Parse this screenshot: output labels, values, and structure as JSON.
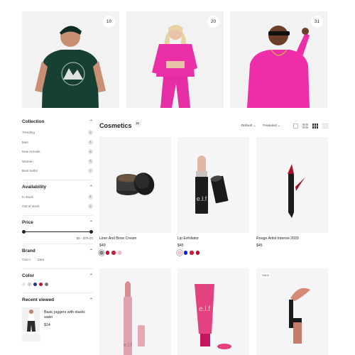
{
  "collections": [
    {
      "count": "10"
    },
    {
      "count": "20"
    },
    {
      "count": "31"
    }
  ],
  "sidebar": {
    "collection": {
      "title": "Collection",
      "items": [
        {
          "label": "Trending",
          "count": "2"
        },
        {
          "label": "Men",
          "count": "4"
        },
        {
          "label": "New Arrivals",
          "count": "6"
        },
        {
          "label": "Women",
          "count": "3"
        },
        {
          "label": "Best Seller",
          "count": "7"
        }
      ]
    },
    "availability": {
      "title": "Availability",
      "items": [
        {
          "label": "In stock",
          "count": "4"
        },
        {
          "label": "Out of stock",
          "count": "2"
        }
      ]
    },
    "price": {
      "title": "Price",
      "range": "$0 - $79.00"
    },
    "brand": {
      "title": "Brand",
      "items": [
        "Gucci",
        "Zara"
      ]
    },
    "color": {
      "title": "Color",
      "swatches": [
        "#e9e6e1",
        "#d9c8b3",
        "#1f2f8f",
        "#c0132f",
        "#7a7a7a"
      ]
    },
    "recent": {
      "title": "Recent viewed",
      "items": [
        {
          "name": "Basic joggers with elastic waist",
          "price": "$14"
        }
      ]
    }
  },
  "main": {
    "title": "Cosmetics",
    "count": "15",
    "sort_default": "Default",
    "sort_featured": "Featured"
  },
  "products": [
    {
      "name": "Liner And Brow Cream",
      "price": "$49",
      "swatches": [
        "#8a8a8a",
        "#c8102e",
        "#d21c3b",
        "#f2b7c0"
      ]
    },
    {
      "name": "Lip Exfoliator",
      "price": "$45",
      "swatches": [
        "#f4c7cf",
        "#1428c8",
        "#d21c3b",
        "#b0102c"
      ]
    },
    {
      "name": "Rouge Artist Intense 2020",
      "price": "$45",
      "swatches": []
    },
    {
      "name": "",
      "price": "",
      "swatches": []
    },
    {
      "name": "",
      "price": "",
      "swatches": []
    },
    {
      "name": "",
      "price": "",
      "swatches": [],
      "badge": "SALE"
    }
  ],
  "colors": {
    "accent": "#222222",
    "card_bg": "#f5f5f7"
  }
}
